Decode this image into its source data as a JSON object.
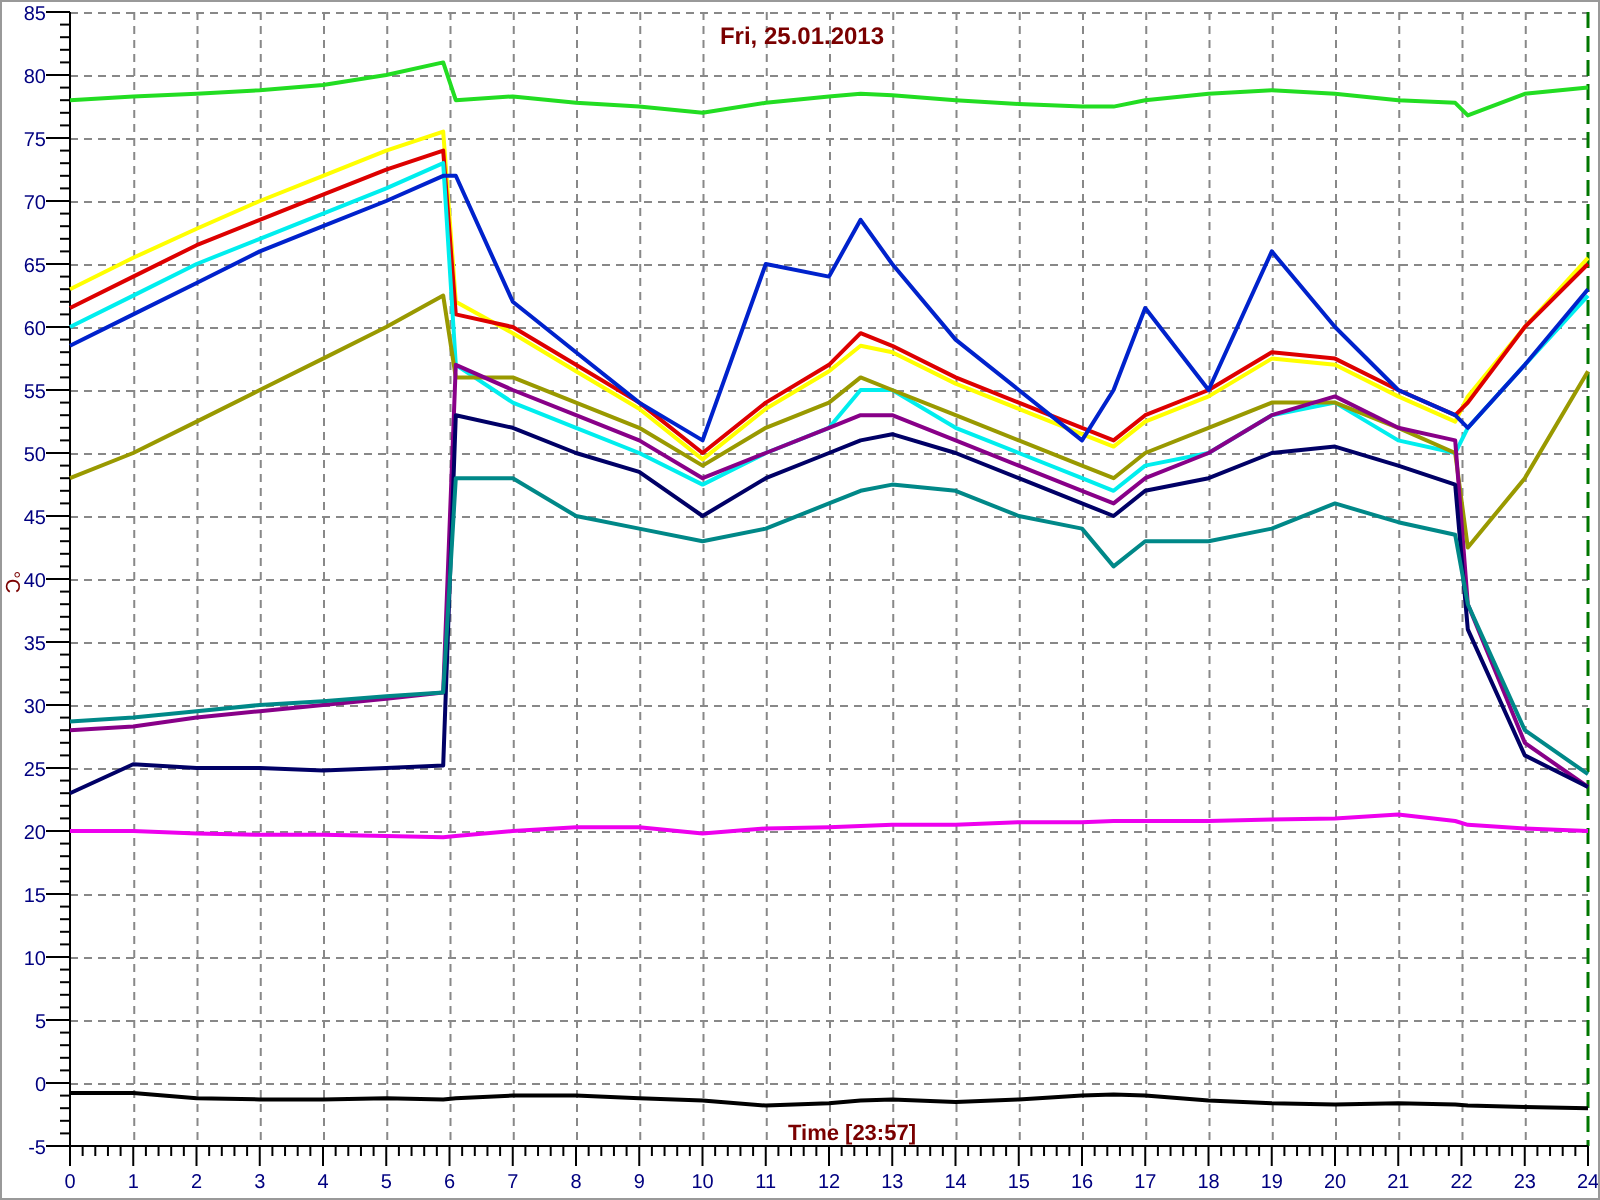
{
  "chart_data": {
    "type": "line",
    "title": "Fri, 25.01.2013",
    "xlabel": "Time [23:57]",
    "ylabel": "°C",
    "x": [
      0,
      1,
      2,
      3,
      4,
      5,
      5.9,
      6.1,
      7,
      8,
      9,
      10,
      11,
      12,
      12.5,
      13,
      14,
      15,
      16,
      16.5,
      17,
      18,
      19,
      20,
      21,
      21.9,
      22.1,
      23,
      24
    ],
    "grid": true,
    "xlim": [
      0,
      24
    ],
    "ylim": [
      -5,
      85
    ],
    "xticks": [
      0,
      1,
      2,
      3,
      4,
      5,
      6,
      7,
      8,
      9,
      10,
      11,
      12,
      13,
      14,
      15,
      16,
      17,
      18,
      19,
      20,
      21,
      22,
      23,
      24
    ],
    "yticks": [
      -5,
      0,
      5,
      10,
      15,
      20,
      25,
      30,
      35,
      40,
      45,
      50,
      55,
      60,
      65,
      70,
      75,
      80,
      85
    ],
    "series": [
      {
        "color": "#22dd22",
        "values": [
          78,
          78.3,
          78.5,
          78.8,
          79.2,
          80,
          81,
          78,
          78.3,
          77.8,
          77.5,
          77,
          77.8,
          78.3,
          78.5,
          78.4,
          78,
          77.7,
          77.5,
          77.5,
          78,
          78.5,
          78.8,
          78.5,
          78,
          77.8,
          76.8,
          78.5,
          79
        ]
      },
      {
        "color": "#ffff00",
        "values": [
          63,
          65.5,
          67.8,
          70,
          72,
          74,
          75.5,
          62,
          59.5,
          56.5,
          53.5,
          49.5,
          53.5,
          56.5,
          58.5,
          58,
          55.5,
          53.5,
          51.5,
          50.5,
          52.5,
          54.5,
          57.5,
          57,
          54.5,
          52.5,
          54.5,
          60,
          65.5
        ]
      },
      {
        "color": "#dd0000",
        "values": [
          61.5,
          64,
          66.5,
          68.5,
          70.5,
          72.5,
          74,
          61,
          60,
          57,
          54,
          50,
          54,
          57,
          59.5,
          58.5,
          56,
          54,
          52,
          51,
          53,
          55,
          58,
          57.5,
          55,
          53,
          54,
          60,
          65
        ]
      },
      {
        "color": "#00eeee",
        "values": [
          60,
          62.5,
          65,
          67,
          69,
          71,
          73,
          57,
          54,
          52,
          50,
          47.5,
          50,
          52,
          55,
          55,
          52,
          50,
          48,
          47,
          49,
          50,
          53,
          54,
          51,
          50,
          52,
          57,
          62.5
        ]
      },
      {
        "color": "#0022cc",
        "values": [
          58.5,
          61,
          63.5,
          66,
          68,
          70,
          72,
          72,
          62,
          58,
          54,
          51,
          65,
          64,
          68.5,
          65,
          59,
          55,
          51,
          55,
          61.5,
          55,
          66,
          60,
          55,
          53,
          52,
          57,
          63
        ]
      },
      {
        "color": "#999900",
        "values": [
          48,
          50,
          52.5,
          55,
          57.5,
          60,
          62.5,
          56,
          56,
          54,
          52,
          49,
          52,
          54,
          56,
          55,
          53,
          51,
          49,
          48,
          50,
          52,
          54,
          54,
          52,
          50,
          42.5,
          48,
          56.5
        ]
      },
      {
        "color": "#880088",
        "values": [
          28,
          28.3,
          29,
          29.5,
          30,
          30.5,
          31,
          57,
          55,
          53,
          51,
          48,
          50,
          52,
          53,
          53,
          51,
          49,
          47,
          46,
          48,
          50,
          53,
          54.5,
          52,
          51,
          38,
          27,
          23.5
        ]
      },
      {
        "color": "#000066",
        "values": [
          23,
          25.3,
          25,
          25,
          24.8,
          25,
          25.2,
          53,
          52,
          50,
          48.5,
          45,
          48,
          50,
          51,
          51.5,
          50,
          48,
          46,
          45,
          47,
          48,
          50,
          50.5,
          49,
          47.5,
          36,
          26,
          23.5
        ]
      },
      {
        "color": "#008888",
        "values": [
          28.7,
          29,
          29.5,
          30,
          30.3,
          30.7,
          31,
          48,
          48,
          45,
          44,
          43,
          44,
          46,
          47,
          47.5,
          47,
          45,
          44,
          41,
          43,
          43,
          44,
          46,
          44.5,
          43.5,
          38,
          28,
          24.5
        ]
      },
      {
        "color": "#ee00ee",
        "values": [
          20,
          20,
          19.8,
          19.7,
          19.7,
          19.6,
          19.5,
          19.6,
          20,
          20.3,
          20.3,
          19.8,
          20.2,
          20.3,
          20.4,
          20.5,
          20.5,
          20.7,
          20.7,
          20.8,
          20.8,
          20.8,
          20.9,
          21,
          21.3,
          20.8,
          20.5,
          20.2,
          20
        ]
      },
      {
        "color": "#000000",
        "values": [
          -0.8,
          -0.8,
          -1.2,
          -1.3,
          -1.3,
          -1.2,
          -1.3,
          -1.2,
          -1,
          -1,
          -1.2,
          -1.4,
          -1.8,
          -1.6,
          -1.4,
          -1.3,
          -1.5,
          -1.3,
          -1,
          -0.9,
          -1,
          -1.4,
          -1.6,
          -1.7,
          -1.6,
          -1.7,
          -1.8,
          -1.9,
          -2
        ]
      }
    ]
  }
}
